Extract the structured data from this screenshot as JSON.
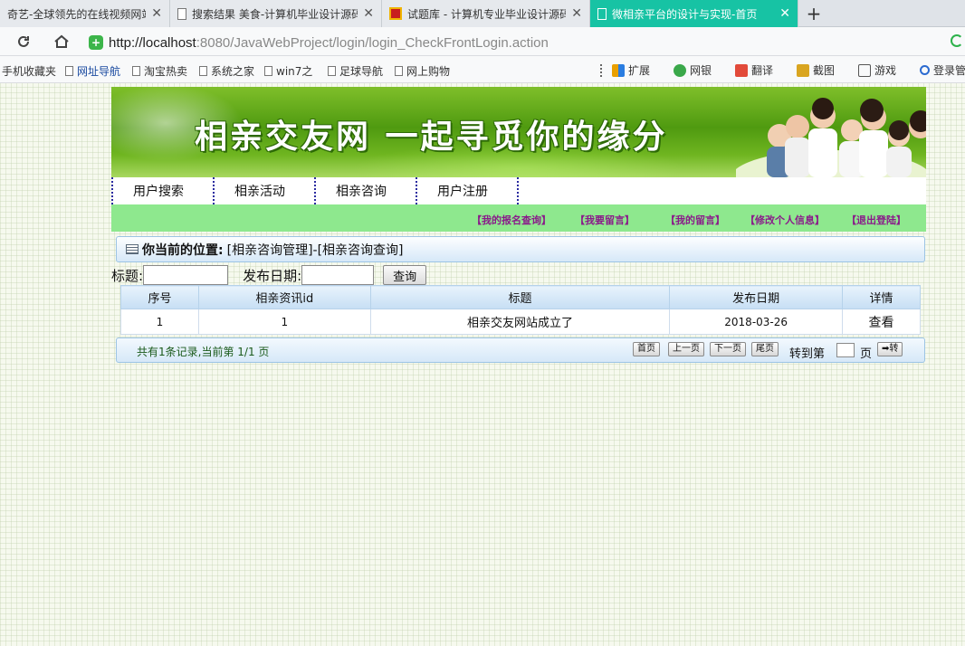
{
  "browser": {
    "tabs": [
      {
        "label": "奇艺-全球领先的在线视频网站"
      },
      {
        "label": "搜索结果 美食-计算机毕业设计源码"
      },
      {
        "label": "试题库 - 计算机专业毕业设计源码"
      },
      {
        "label": "微相亲平台的设计与实现-首页"
      }
    ],
    "close_glyph": "✕",
    "new_tab_glyph": "+",
    "url_host": "http://localhost",
    "url_rest": ":8080/JavaWebProject/login/login_CheckFrontLogin.action",
    "bookmarks": [
      "手机收藏夹",
      "网址导航",
      "淘宝热卖",
      "系统之家",
      "win7之",
      "足球导航",
      "网上购物"
    ],
    "tools": [
      "扩展",
      "网银",
      "翻译",
      "截图",
      "游戏",
      "登录管"
    ],
    "accent": "#17c3a4"
  },
  "site": {
    "banner_title": "相亲交友网 一起寻觅你的缘分",
    "nav": [
      "用户搜索",
      "相亲活动",
      "相亲咨询",
      "用户注册"
    ],
    "subnav": [
      "【我的报名查询】",
      "【我要留言】",
      "【我的留言】",
      "【修改个人信息】",
      "【退出登陆】"
    ],
    "crumb_label": "你当前的位置:",
    "crumb_path": "[相亲咨询管理]-[相亲咨询查询]",
    "search": {
      "title_label": "标题:",
      "date_label": "发布日期:",
      "title_value": "",
      "date_value": "",
      "query_button": "查询"
    },
    "table": {
      "headers": [
        "序号",
        "相亲资讯id",
        "标题",
        "发布日期",
        "详情"
      ],
      "rows": [
        {
          "index": "1",
          "id": "1",
          "title": "相亲交友网站成立了",
          "date": "2018-03-26",
          "detail": "查看"
        }
      ]
    },
    "pager": {
      "info": "共有1条记录,当前第 1/1 页",
      "first": "首页",
      "prev": "上一页",
      "next": "下一页",
      "last": "尾页",
      "goto_label": "转到第",
      "page_unit": "页",
      "go": "➡转",
      "goto_value": ""
    }
  }
}
